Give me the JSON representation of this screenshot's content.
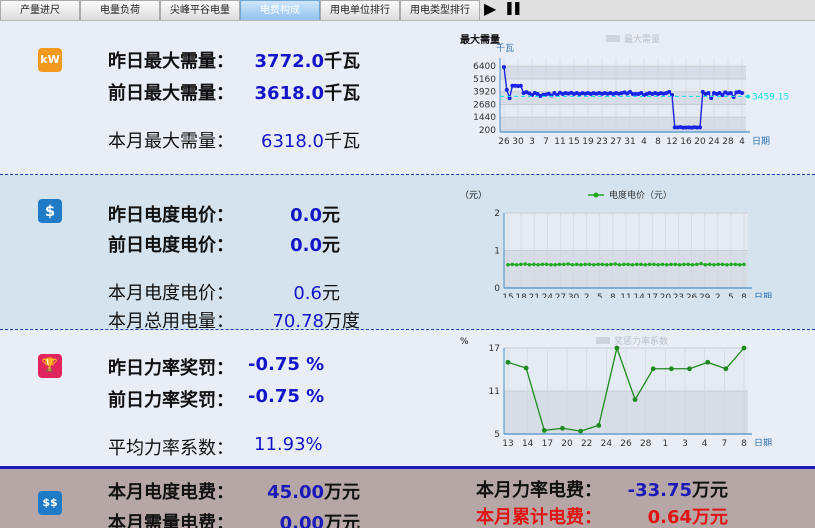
{
  "tabs": [
    {
      "label": "产量进尺",
      "active": false
    },
    {
      "label": "电量负荷",
      "active": false
    },
    {
      "label": "尖峰平谷电量",
      "active": false
    },
    {
      "label": "电费构成",
      "active": true
    },
    {
      "label": "用电单位排行",
      "active": false
    },
    {
      "label": "用电类型排行",
      "active": false
    }
  ],
  "controls": {
    "play": "▶",
    "pause": "❚❚"
  },
  "demand": {
    "icon_text": "kW",
    "icon_color": "#f39a1e",
    "yesterday_label": "昨日最大需量：",
    "yesterday_value": "3772.0",
    "yesterday_unit": "千瓦",
    "daybefore_label": "前日最大需量：",
    "daybefore_value": "3618.0",
    "daybefore_unit": "千瓦",
    "month_label": "本月最大需量：",
    "month_value": "6318.0",
    "month_unit": "千瓦"
  },
  "price": {
    "icon_text": "$",
    "icon_color": "#1f7bc6",
    "yesterday_label": "昨日电度电价：",
    "yesterday_value": "0.0",
    "yesterday_unit": "元",
    "daybefore_label": "前日电度电价：",
    "daybefore_value": "0.0",
    "daybefore_unit": "元",
    "month_label": "本月电度电价：",
    "month_value": "0.6",
    "month_unit": "元",
    "total_label": "本月总用电量：",
    "total_value": "70.78",
    "total_unit": "万度"
  },
  "power_factor": {
    "icon_text": "🏆",
    "icon_color": "#e0245e",
    "yesterday_label": "昨日力率奖罚：",
    "yesterday_value": "-0.75 %",
    "daybefore_label": "前日力率奖罚：",
    "daybefore_value": "-0.75 %",
    "avg_label": "平均力率系数：",
    "avg_value": "11.93%"
  },
  "fees": {
    "icon_text": "$$",
    "icon_color": "#1f7bc6",
    "energy_label": "本月电度电费：",
    "energy_value": "45.00",
    "energy_unit": "万元",
    "demand_label": "本月需量电费：",
    "demand_value": "0.00",
    "demand_unit": "万元",
    "pf_label": "本月力率电费：",
    "pf_value": "-33.75",
    "pf_unit": "万元",
    "total_label": "本月累计电费：",
    "total_value": "0.64",
    "total_unit": "万元"
  },
  "chart_data": [
    {
      "type": "line",
      "title": "最大需量",
      "ylabel": "千瓦",
      "xlabel": "日期",
      "legend": "最大需量",
      "legend_position": "top-right",
      "yticks": [
        200,
        1440,
        2680,
        3920,
        5160,
        6400
      ],
      "ylim": [
        0,
        7200
      ],
      "xtick_labels": [
        "26",
        "30",
        "3",
        "7",
        "11",
        "15",
        "19",
        "23",
        "27",
        "31",
        "4",
        "8",
        "12",
        "16",
        "20",
        "24",
        "28",
        "4"
      ],
      "ref_line": {
        "value": 3459.15,
        "label": "3459.15",
        "color": "#19e0e0"
      },
      "line_color": "#1a22e6",
      "series": [
        {
          "values": [
            6318,
            4100,
            3300,
            4500,
            4500,
            4480,
            4500,
            3800,
            3880,
            3760,
            3600,
            3800,
            3700,
            3500,
            3620,
            3650,
            3720,
            3550,
            3800,
            3600,
            3820,
            3700,
            3800,
            3730,
            3820,
            3700,
            3800,
            3690,
            3780,
            3720,
            3800,
            3700,
            3780,
            3720,
            3800,
            3710,
            3790,
            3720,
            3800,
            3700,
            3800,
            3720,
            3780,
            3850,
            3750,
            3900,
            3700,
            3700,
            3700,
            3800,
            3600,
            3700,
            3800,
            3700,
            3800,
            3700,
            3780,
            3720,
            3800,
            3900,
            3600,
            450,
            450,
            470,
            430,
            440,
            450,
            430,
            460,
            440,
            450,
            3900,
            3700,
            3800,
            3300,
            3800,
            3700,
            3800,
            3600,
            3850,
            3750,
            3800,
            3400,
            3850,
            3900,
            3800
          ]
        }
      ]
    },
    {
      "type": "line",
      "title": "",
      "ylabel": "（元）",
      "xlabel": "日期",
      "legend": "电度电价（元）",
      "legend_position": "top",
      "yticks": [
        0,
        1,
        2
      ],
      "ylim": [
        0,
        2
      ],
      "xtick_labels": [
        "15",
        "18",
        "21",
        "24",
        "27",
        "30",
        "2",
        "5",
        "8",
        "11",
        "14",
        "17",
        "20",
        "23",
        "26",
        "29",
        "2",
        "5",
        "8"
      ],
      "line_color": "#22aa22",
      "series": [
        {
          "values": [
            0.62,
            0.63,
            0.62,
            0.63,
            0.64,
            0.62,
            0.63,
            0.62,
            0.63,
            0.63,
            0.62,
            0.62,
            0.63,
            0.63,
            0.64,
            0.62,
            0.63,
            0.62,
            0.63,
            0.63,
            0.62,
            0.63,
            0.63,
            0.62,
            0.63,
            0.64,
            0.62,
            0.63,
            0.63,
            0.62,
            0.63,
            0.63,
            0.62,
            0.63,
            0.63,
            0.62,
            0.63,
            0.62,
            0.63,
            0.63,
            0.62,
            0.63,
            0.63,
            0.62,
            0.63,
            0.65,
            0.62,
            0.63,
            0.62,
            0.63,
            0.63,
            0.62,
            0.63,
            0.63,
            0.62,
            0.63
          ]
        }
      ]
    },
    {
      "type": "line",
      "title": "",
      "ylabel": "%",
      "xlabel": "日期",
      "legend": "奖惩力率系数",
      "legend_position": "top-right",
      "yticks": [
        5,
        11,
        17
      ],
      "ylim": [
        5,
        17
      ],
      "xtick_labels": [
        "13",
        "14",
        "17",
        "20",
        "22",
        "24",
        "26",
        "28",
        "1",
        "3",
        "4",
        "7",
        "8"
      ],
      "line_color": "#1f8a1f",
      "series": [
        {
          "values": [
            15.0,
            14.2,
            5.5,
            5.8,
            5.4,
            6.2,
            17.0,
            9.8,
            14.1,
            14.1,
            14.1,
            15.0,
            14.1,
            17.0
          ]
        }
      ]
    }
  ]
}
